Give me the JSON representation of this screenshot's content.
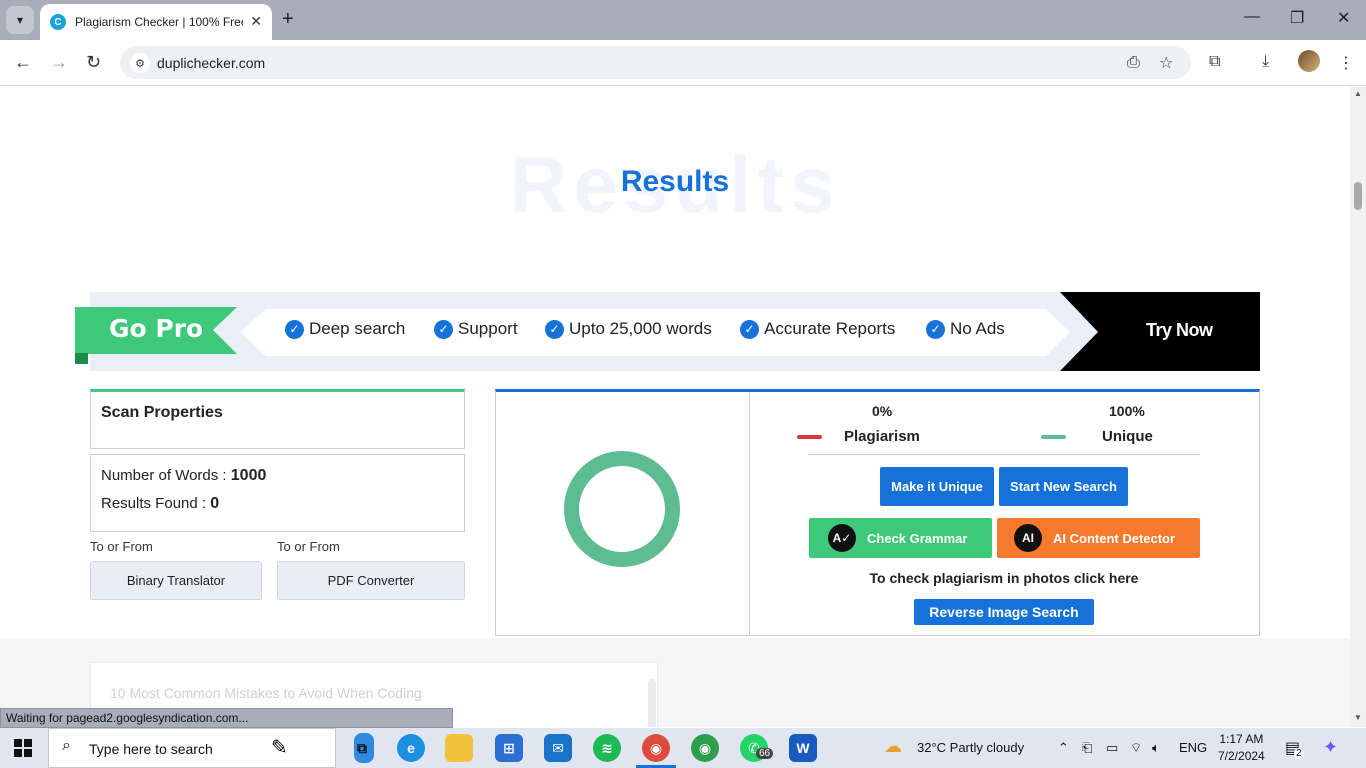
{
  "browser": {
    "tab_title": "Plagiarism Checker | 100% Free",
    "url": "duplichecker.com",
    "status_text": "Waiting for pagead2.googlesyndication.com..."
  },
  "page": {
    "ghost_heading": "Results",
    "heading": "Results",
    "gopro": {
      "label": "Go Pro",
      "features": [
        "Deep search",
        "Support",
        "Upto 25,000 words",
        "Accurate Reports",
        "No Ads"
      ],
      "cta": "Try Now"
    },
    "scan": {
      "title": "Scan Properties",
      "words_label": "Number of Words :",
      "words_value": "1000",
      "results_label": "Results Found :",
      "results_value": "0"
    },
    "tools": [
      {
        "label": "To or From",
        "button": "Binary Translator"
      },
      {
        "label": "To or From",
        "button": "PDF Converter"
      }
    ],
    "result": {
      "plagiarism_pct": "0%",
      "plagiarism_label": "Plagiarism",
      "unique_pct": "100%",
      "unique_label": "Unique",
      "unique_fraction": 1.0,
      "make_unique": "Make it Unique",
      "new_search": "Start New Search",
      "check_grammar": "Check Grammar",
      "ai_detector": "AI Content Detector",
      "photo_text": "To check plagiarism in photos click here",
      "reverse_image": "Reverse Image Search"
    },
    "article_title": "10 Most Common Mistakes to Avoid When Coding"
  },
  "taskbar": {
    "search_placeholder": "Type here to search",
    "whatsapp_badge": "66",
    "weather": "32°C  Partly cloudy",
    "lang": "ENG",
    "time": "1:17 AM",
    "date": "7/2/2024",
    "notif_count": "2"
  },
  "colors": {
    "brand_blue": "#1672d9",
    "go_pro_green": "#3ec97a",
    "unique_green": "#5dbc91",
    "plagiarism_red": "#d33a3a",
    "grammar_green": "#3ec97a",
    "ai_orange": "#f77a2c"
  }
}
